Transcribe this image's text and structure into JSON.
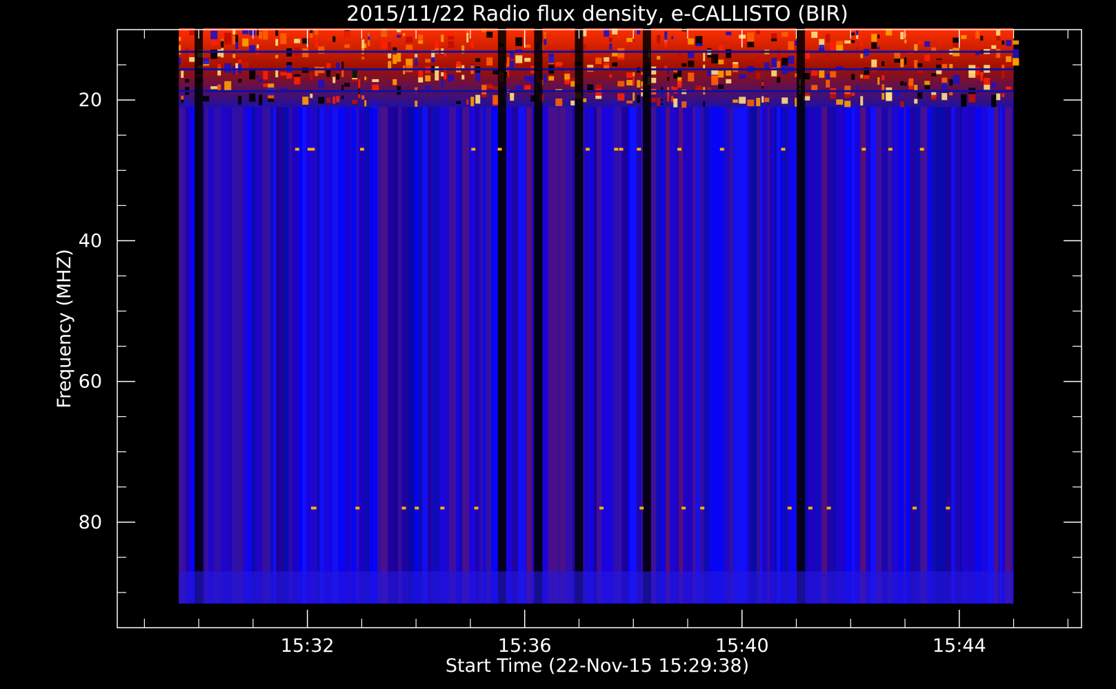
{
  "chart_data": {
    "type": "heatmap",
    "title": "2015/11/22  Radio flux density, e-CALLISTO (BIR)",
    "xlabel": "Start Time (22-Nov-15 15:29:38)",
    "ylabel": "Frequency (MHZ)",
    "x_range_minutes": [
      "15:29:38",
      "15:45:00"
    ],
    "xlim": [
      "15:28:30",
      "15:46:15"
    ],
    "ylim": [
      10,
      95
    ],
    "y_range_data": [
      10,
      90
    ],
    "y_inverted": true,
    "x_ticks": [
      "15:32",
      "15:36",
      "15:40",
      "15:44"
    ],
    "y_ticks": [
      20,
      40,
      60,
      80
    ],
    "colormap": [
      "#000000",
      "#1a00c8",
      "#0000ff",
      "#800000",
      "#ff3000",
      "#ffb000",
      "#ffffff"
    ],
    "features": {
      "bright_band_mhz": [
        10,
        21
      ],
      "dark_time_stripes": [
        "15:30:00",
        "15:35:35",
        "15:36:15",
        "15:37:00",
        "15:38:15",
        "15:41:05"
      ],
      "narrow_emission_lines_mhz": [
        27,
        78
      ]
    }
  },
  "colors": {
    "background": "#000000",
    "axes": "#ffffff",
    "text": "#ffffff"
  }
}
